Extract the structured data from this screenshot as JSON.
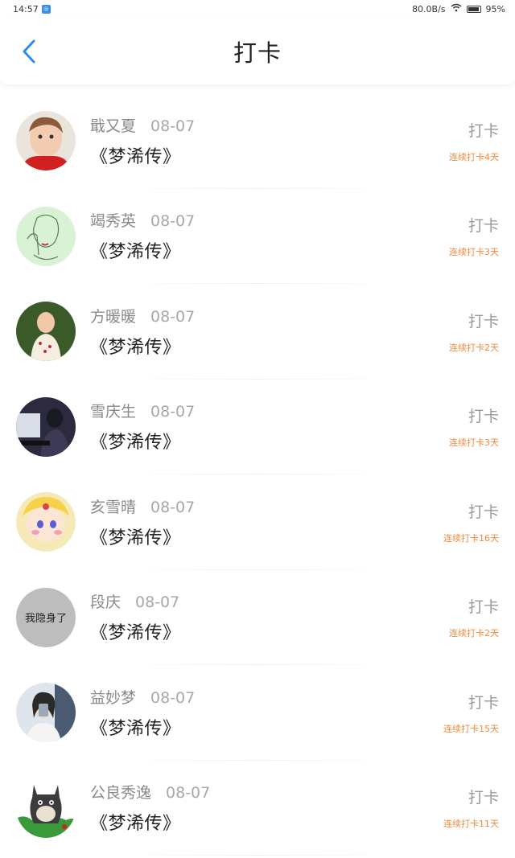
{
  "status_bar": {
    "time": "14:57",
    "network_speed": "80.0B/s",
    "battery": "95%"
  },
  "header": {
    "title": "打卡"
  },
  "colors": {
    "accent": "#2f8fe6",
    "streak": "#f08a3c",
    "muted": "#8a8a8a"
  },
  "checkins": [
    {
      "name": "戢又夏",
      "date": "08-07",
      "book": "《梦浠传》",
      "button": "打卡",
      "streak": "连续打卡4天"
    },
    {
      "name": "竭秀英",
      "date": "08-07",
      "book": "《梦浠传》",
      "button": "打卡",
      "streak": "连续打卡3天"
    },
    {
      "name": "方暖暖",
      "date": "08-07",
      "book": "《梦浠传》",
      "button": "打卡",
      "streak": "连续打卡2天"
    },
    {
      "name": "雪庆生",
      "date": "08-07",
      "book": "《梦浠传》",
      "button": "打卡",
      "streak": "连续打卡3天"
    },
    {
      "name": "亥雪晴",
      "date": "08-07",
      "book": "《梦浠传》",
      "button": "打卡",
      "streak": "连续打卡16天"
    },
    {
      "name": "段庆",
      "date": "08-07",
      "book": "《梦浠传》",
      "button": "打卡",
      "streak": "连续打卡2天",
      "avatar_text": "我隐身了"
    },
    {
      "name": "益妙梦",
      "date": "08-07",
      "book": "《梦浠传》",
      "button": "打卡",
      "streak": "连续打卡15天"
    },
    {
      "name": "公良秀逸",
      "date": "08-07",
      "book": "《梦浠传》",
      "button": "打卡",
      "streak": "连续打卡11天"
    }
  ]
}
